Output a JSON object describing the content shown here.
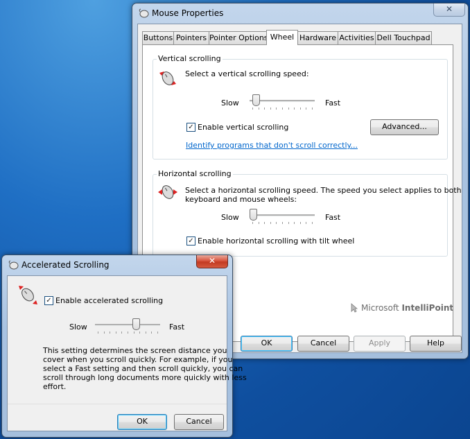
{
  "main_window": {
    "title": "Mouse Properties",
    "close_label": "✕",
    "tabs": [
      {
        "label": "Buttons"
      },
      {
        "label": "Pointers"
      },
      {
        "label": "Pointer Options"
      },
      {
        "label": "Wheel",
        "selected": true
      },
      {
        "label": "Hardware"
      },
      {
        "label": "Activities"
      },
      {
        "label": "Dell Touchpad"
      }
    ],
    "vertical": {
      "group_label": "Vertical scrolling",
      "prompt": "Select a vertical scrolling speed:",
      "slow": "Slow",
      "fast": "Fast",
      "speed_fraction": 0.05,
      "enable_label": "Enable vertical scrolling",
      "enable_checked": true,
      "advanced_button": "Advanced...",
      "link": "Identify programs that don't scroll correctly..."
    },
    "horizontal": {
      "group_label": "Horizontal scrolling",
      "prompt_line1": "Select a horizontal scrolling speed. The speed you select applies to both",
      "prompt_line2": "keyboard and mouse wheels:",
      "slow": "Slow",
      "fast": "Fast",
      "speed_fraction": 0.0,
      "enable_label": "Enable horizontal scrolling with tilt wheel",
      "enable_checked": true
    },
    "brand_prefix": "Microsoft",
    "brand_name": "IntelliPoint",
    "buttons": {
      "ok": "OK",
      "cancel": "Cancel",
      "apply": "Apply",
      "help": "Help"
    }
  },
  "accel_dialog": {
    "title": "Accelerated Scrolling",
    "close_label": "✕",
    "enable_label": "Enable accelerated scrolling",
    "enable_checked": true,
    "slow": "Slow",
    "fast": "Fast",
    "speed_fraction": 0.65,
    "desc_line1": "This setting determines the screen distance you",
    "desc_line2": "cover when you scroll quickly.  For example, if you",
    "desc_line3": "select a Fast setting and then scroll quickly, you can",
    "desc_line4": "scroll through long documents more quickly with less",
    "desc_line5": "effort.",
    "ok": "OK",
    "cancel": "Cancel"
  },
  "colors": {
    "link": "#0066cc",
    "close_red": "#c23a22",
    "accent_blue": "#3c7fb1"
  }
}
